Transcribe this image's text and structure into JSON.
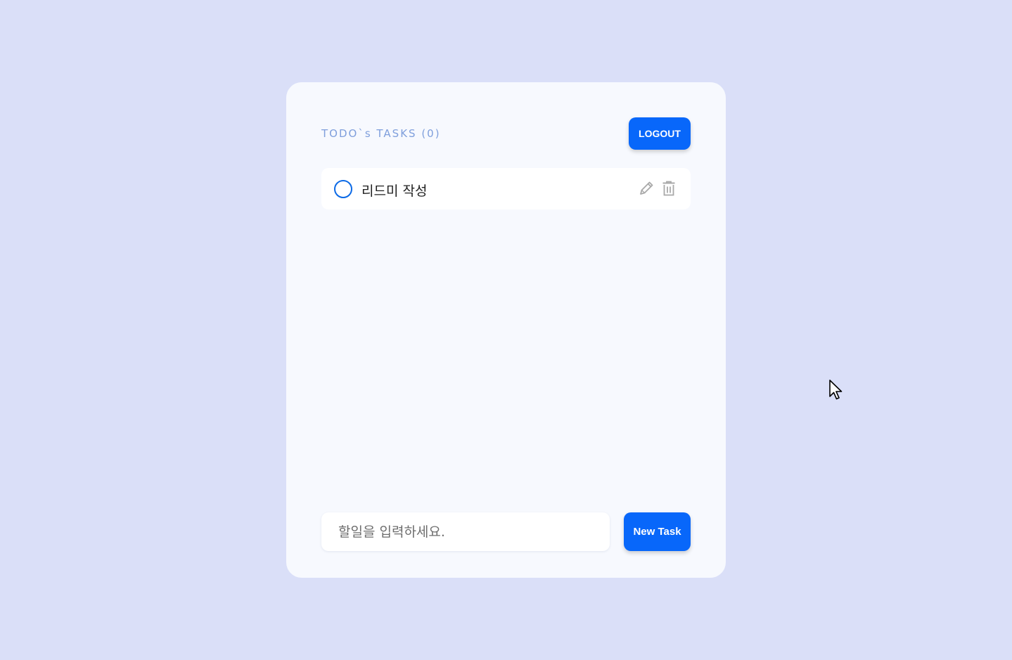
{
  "header": {
    "title": "TODO`s TASKS (0)",
    "logout_label": "LOGOUT"
  },
  "tasks": [
    {
      "label": "리드미 작성",
      "completed": false,
      "edit_icon": "pencil-icon",
      "delete_icon": "trash-icon"
    }
  ],
  "new_task": {
    "placeholder": "할일을 입력하세요.",
    "value": "",
    "button_label": "New Task"
  },
  "colors": {
    "background": "#dadff8",
    "card": "#f7f9fe",
    "accent": "#0867fa",
    "title": "#7f9fdc",
    "checkbox_border": "#0c6ae6",
    "icon": "#a9a9a9"
  },
  "cursor": {
    "icon": "mouse-pointer-icon"
  }
}
